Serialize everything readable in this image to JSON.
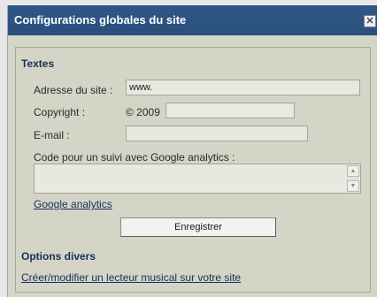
{
  "window": {
    "title": "Configurations globales du site",
    "close_glyph": "✕"
  },
  "textes": {
    "title": "Textes",
    "adresse_label": "Adresse du site :",
    "adresse_value": "www.",
    "copyright_label": "Copyright :",
    "copyright_prefix": "© 2009",
    "copyright_value": "",
    "email_label": "E-mail :",
    "email_value": "",
    "analytics_label": "Code pour un suivi avec Google analytics :",
    "analytics_value": "",
    "analytics_link": "Google analytics",
    "save_label": "Enregistrer"
  },
  "options": {
    "title": "Options divers",
    "music_link": "Créer/modifier un lecteur musical sur votre site"
  },
  "colors": {
    "titlebar": "#2f5786",
    "panel": "#d4d4c7",
    "heading": "#16305a"
  },
  "icons": {
    "close": "close-icon",
    "scroll_up": "chevron-up-icon",
    "scroll_down": "chevron-down-icon"
  }
}
